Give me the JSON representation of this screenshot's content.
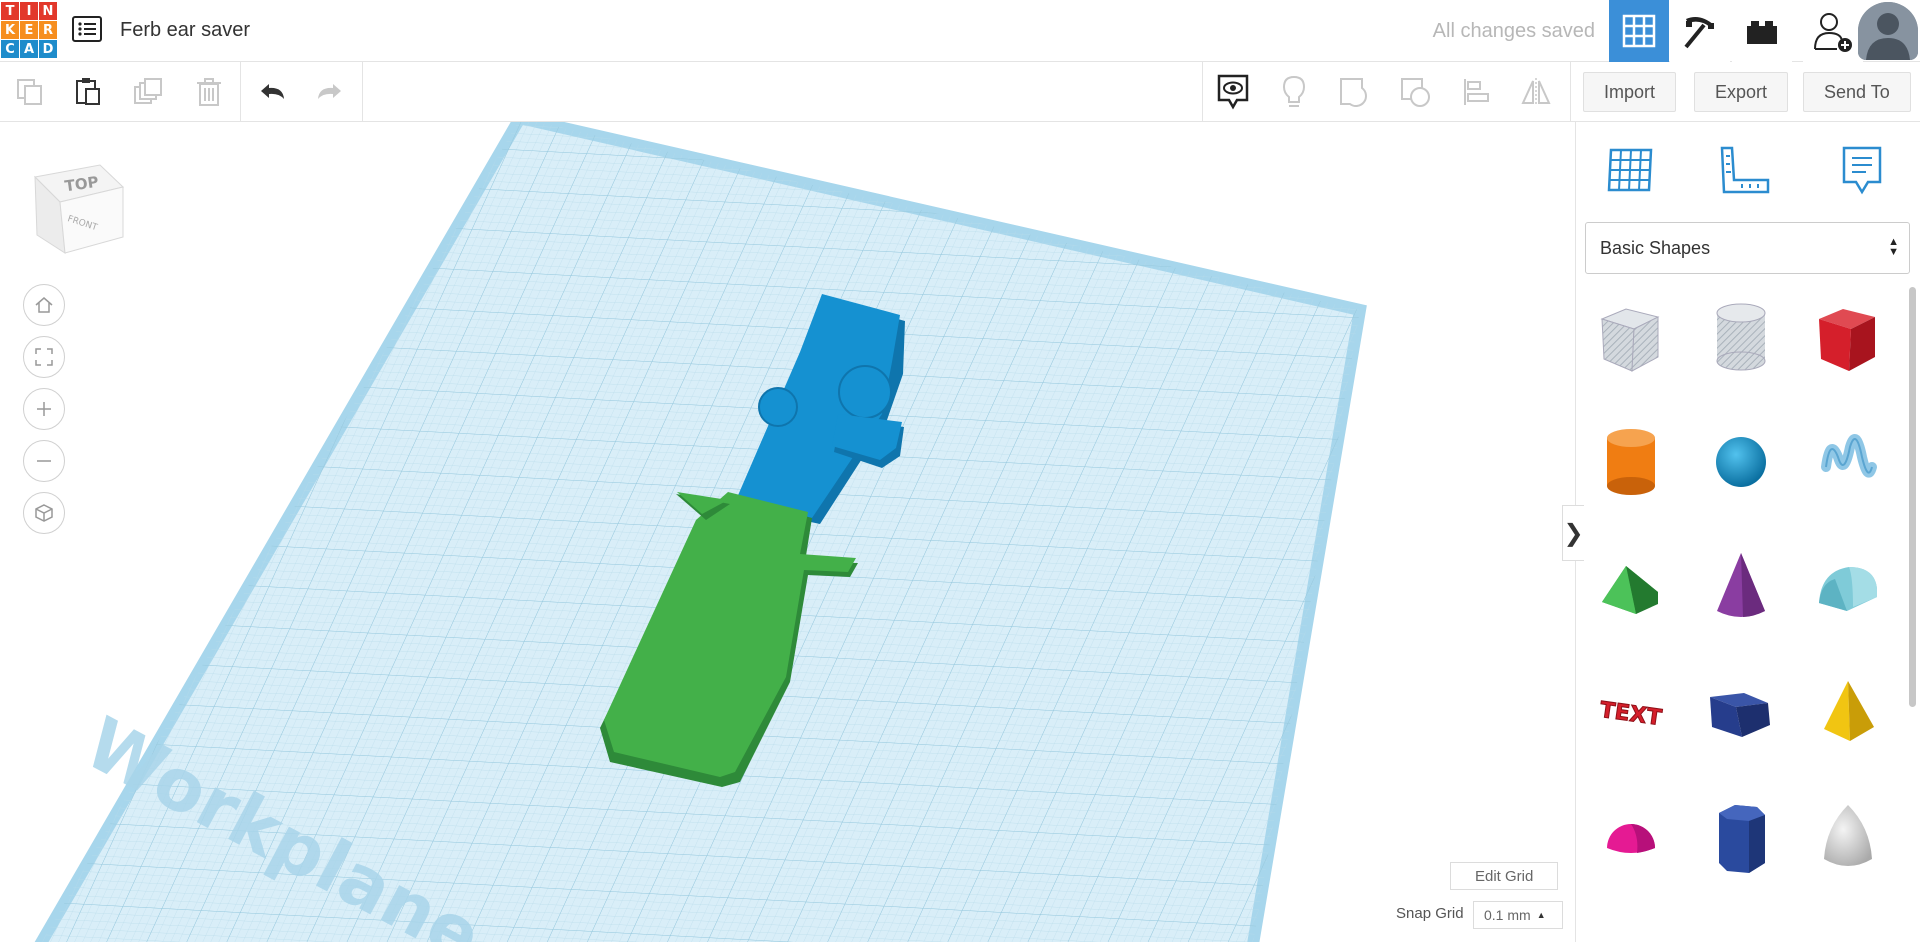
{
  "app": {
    "logo_letters": [
      "T",
      "I",
      "N",
      "K",
      "E",
      "R",
      "C",
      "A",
      "D"
    ],
    "logo_colors": [
      "#e2382b",
      "#e2382b",
      "#e2382b",
      "#f68e1f",
      "#f68e1f",
      "#f68e1f",
      "#1e8ccb",
      "#1e8ccb",
      "#1e8ccb"
    ],
    "design_title": "Ferb ear saver",
    "save_status": "All changes saved",
    "accent": "#3b8fd8"
  },
  "topbar": {
    "icons": [
      "design-list-icon",
      "3d-design-grid-icon",
      "pickaxe-build-icon",
      "bricks-icon",
      "invite-user-icon",
      "avatar"
    ]
  },
  "toolbar": {
    "tools": [
      "copy-icon",
      "paste-icon",
      "duplicate-icon",
      "delete-icon",
      "undo-icon",
      "redo-icon"
    ],
    "view_tools": [
      "notes-visibility-icon",
      "light-bulb-icon",
      "group-icon",
      "ungroup-icon",
      "align-icon",
      "mirror-icon"
    ],
    "import_label": "Import",
    "export_label": "Export",
    "send_to_label": "Send To"
  },
  "viewport": {
    "view_cube": {
      "top_label": "TOP",
      "front_label": "FRONT"
    },
    "nav_icons": [
      "home-view-icon",
      "fit-view-icon",
      "zoom-in-icon",
      "zoom-out-icon",
      "perspective-icon"
    ],
    "workplane_label": "Workplane",
    "edit_grid_label": "Edit Grid",
    "snap_grid_label": "Snap Grid",
    "snap_grid_value": "0.1 mm",
    "panel_toggle": "❯",
    "shape_colors": {
      "top_part": "#1591d1",
      "bottom_part": "#43b049"
    }
  },
  "right_panel": {
    "tabs": [
      "workplane-grid-icon",
      "ruler-icon",
      "notes-icon"
    ],
    "category": "Basic Shapes",
    "shapes": [
      {
        "name": "box-hole",
        "color": "#bfc6cf"
      },
      {
        "name": "cylinder-hole",
        "color": "#c9ced4"
      },
      {
        "name": "box",
        "color": "#d51f2b"
      },
      {
        "name": "cylinder",
        "color": "#f07d12"
      },
      {
        "name": "sphere",
        "color": "#159bd7"
      },
      {
        "name": "scribble",
        "color": "#8fc7e6"
      },
      {
        "name": "roof",
        "color": "#3aa847"
      },
      {
        "name": "cone",
        "color": "#8a3da1"
      },
      {
        "name": "round-roof",
        "color": "#7fcbd8"
      },
      {
        "name": "text",
        "color": "#d51f2b"
      },
      {
        "name": "wedge",
        "color": "#263d8c"
      },
      {
        "name": "pyramid",
        "color": "#f1c512"
      },
      {
        "name": "half-sphere",
        "color": "#e51a93"
      },
      {
        "name": "polygon",
        "color": "#2a4a9e"
      },
      {
        "name": "paraboloid",
        "color": "#d9d9d9"
      }
    ],
    "text_shape_label": "TEXT"
  }
}
